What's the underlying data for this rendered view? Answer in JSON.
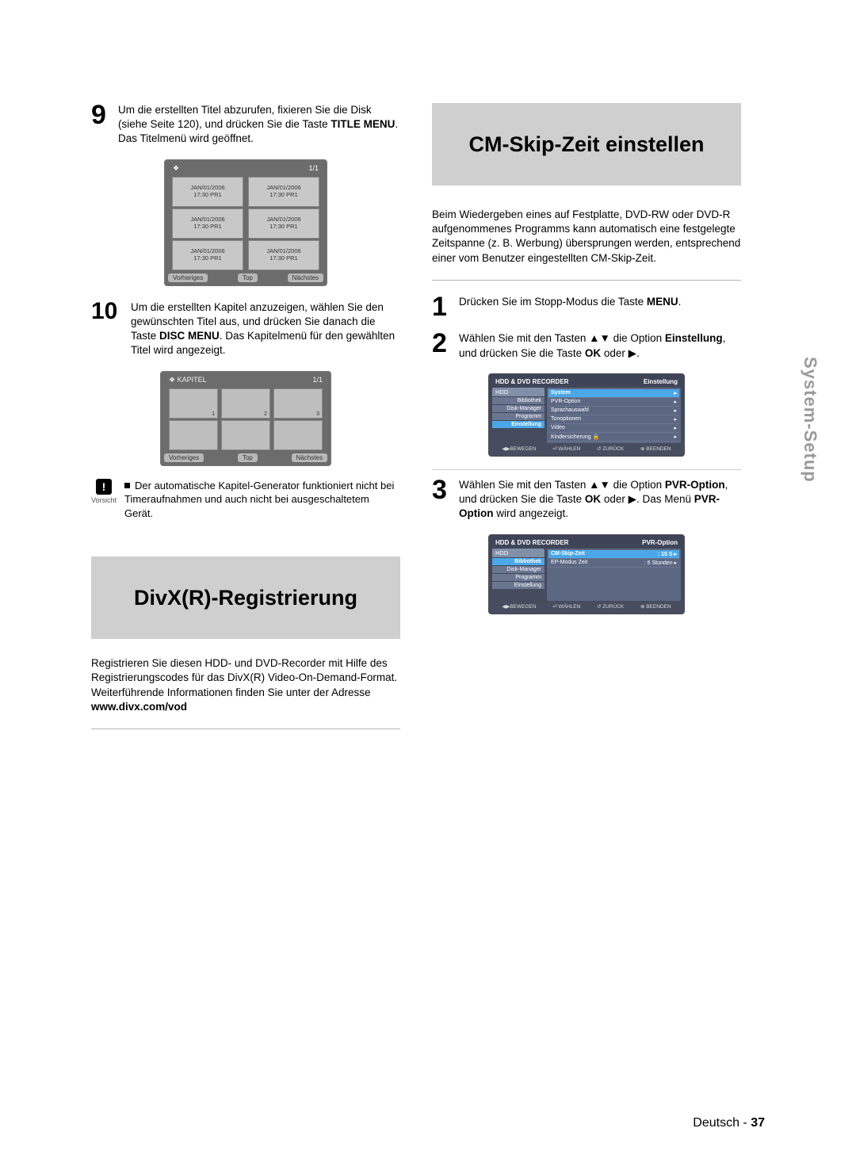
{
  "sideTab": "System-Setup",
  "footer": {
    "lang": "Deutsch - ",
    "page": "37"
  },
  "left": {
    "step9": {
      "num": "9",
      "pre": "Um die erstellten Titel abzurufen, fixieren Sie die Disk (siehe Seite 120), und drücken Sie die Taste ",
      "bold": "TITLE MENU",
      "post": ". Das Titelmenü wird geöffnet."
    },
    "titlesUI": {
      "glyph": "❖",
      "page": "1/1",
      "cell_line1": "JAN/01/2006",
      "cell_line2": "17:30 PR1",
      "btn_prev": "Vorheriges",
      "btn_top": "Top",
      "btn_next": "Nächstes"
    },
    "step10": {
      "num": "10",
      "pre": "Um die erstellten Kapitel anzuzeigen, wählen Sie den gewünschten Titel aus, und drücken Sie danach die Taste ",
      "bold": "DISC MENU",
      "post": ". Das Kapitelmenü für den gewählten Titel wird angezeigt."
    },
    "kapitelUI": {
      "head": "❖   KAPITEL",
      "page": "1/1",
      "n": [
        "1",
        "2",
        "3"
      ],
      "btn_prev": "Vorheriges",
      "btn_top": "Top",
      "btn_next": "Nächstes"
    },
    "caution": {
      "label": "Vorsicht",
      "text": "Der automatische Kapitel-Generator funktioniert nicht bei Timeraufnahmen und auch nicht bei ausgeschaltetem Gerät."
    },
    "divxTitle": "DivX(R)-Registrierung",
    "divxParaPre": "Registrieren Sie diesen HDD- und DVD-Recorder mit Hilfe des Registrierungscodes für das DivX(R) Video-On-Demand-Format. Weiterführende Informationen finden Sie unter der Adresse ",
    "divxBold": "www.divx.com/vod"
  },
  "right": {
    "cmTitle": "CM-Skip-Zeit einstellen",
    "cmPara": "Beim Wiedergeben eines auf Festplatte, DVD-RW oder DVD-R aufgenommenes Programms kann automatisch eine festgelegte Zeitspanne (z. B. Werbung) übersprungen werden, entsprechend einer vom Benutzer eingestellten CM-Skip-Zeit.",
    "step1": {
      "num": "1",
      "pre": "Drücken Sie im Stopp-Modus die Taste ",
      "bold": "MENU",
      "post": "."
    },
    "step2": {
      "num": "2",
      "a": "Wählen Sie mit den Tasten ▲▼ die Option ",
      "b": "Einstellung",
      "c": ", und drücken Sie die Taste ",
      "d": "OK",
      "e": " oder ▶."
    },
    "panel1": {
      "title": "HDD & DVD RECORDER",
      "right": "Einstellung",
      "sideHead": "HDD",
      "side": [
        "Bibliothek",
        "Disk-Manager",
        "Programm",
        "Einstellung"
      ],
      "sideSelIndex": 3,
      "rows": [
        {
          "l": "System",
          "r": "▸",
          "sel": true
        },
        {
          "l": "PVR-Option",
          "r": "▸"
        },
        {
          "l": "Sprachauswahl",
          "r": "▸"
        },
        {
          "l": "Tonoptionen",
          "r": "▸"
        },
        {
          "l": "Video",
          "r": "▸"
        },
        {
          "l": "Kindersicherung 🔒",
          "r": "▸"
        }
      ],
      "foot": [
        "◀▶BEWEGEN",
        "⏎ WÄHLEN",
        "↺ ZURÜCK",
        "⊗ BEENDEN"
      ]
    },
    "step3": {
      "num": "3",
      "a": "Wählen Sie mit den Tasten ▲▼ die Option ",
      "b": "PVR-Option",
      "c": ", und drücken Sie die Taste ",
      "d": "OK",
      "e": " oder ▶. Das Menü ",
      "f": "PVR-Option",
      "g": " wird angezeigt."
    },
    "panel2": {
      "title": "HDD & DVD RECORDER",
      "right": "PVR-Option",
      "sideHead": "HDD",
      "side": [
        "Bibliothek",
        "Disk-Manager",
        "Programm",
        "Einstellung"
      ],
      "sideSelIndex": 0,
      "rows": [
        {
          "l": "CM-Skip-Zeit",
          "r": ": 15 S    ▸",
          "sel": true
        },
        {
          "l": "EP-Modus Zeit",
          "r": ": 6 Stunden  ▸"
        }
      ],
      "foot": [
        "◀▶BEWEGEN",
        "⏎ WÄHLEN",
        "↺ ZURÜCK",
        "⊗ BEENDEN"
      ]
    }
  }
}
